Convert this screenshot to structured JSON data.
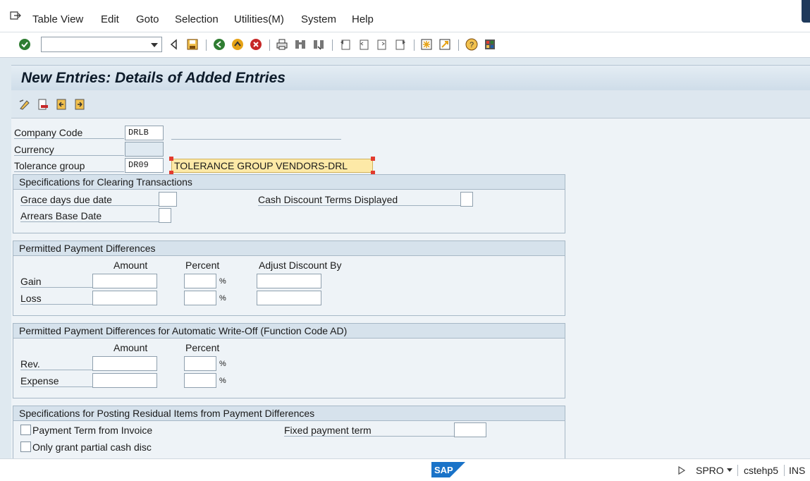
{
  "menubar": {
    "items": [
      "Table View",
      "Edit",
      "Goto",
      "Selection",
      "Utilities(M)",
      "System",
      "Help"
    ]
  },
  "toolbar": {
    "command_value": "",
    "icons": [
      "enter-icon",
      "back-icon",
      "save-icon",
      "back-green-icon",
      "exit-icon",
      "cancel-icon",
      "print-icon",
      "find-icon",
      "find-next-icon",
      "first-page-icon",
      "prev-page-icon",
      "next-page-icon",
      "last-page-icon",
      "create-session-icon",
      "shortcut-icon",
      "help-icon",
      "layout-icon"
    ]
  },
  "screen": {
    "title": "New Entries: Details of Added Entries"
  },
  "app_toolbar": {
    "icons": [
      "change-display-icon",
      "delete-icon",
      "previous-entry-icon",
      "next-entry-icon"
    ]
  },
  "header": {
    "company_code_label": "Company Code",
    "company_code_value": "DRLB",
    "currency_label": "Currency",
    "currency_value": "",
    "tolerance_group_label": "Tolerance group",
    "tolerance_group_value": "DR09",
    "tolerance_group_desc": "TOLERANCE GROUP VENDORS-DRL"
  },
  "clearing": {
    "title": "Specifications for Clearing Transactions",
    "grace_days_label": "Grace days due date",
    "grace_days_value": "",
    "cash_discount_label": "Cash Discount Terms Displayed",
    "cash_discount_value": "",
    "arrears_label": "Arrears Base Date",
    "arrears_value": ""
  },
  "payment_diff": {
    "title": "Permitted Payment Differences",
    "col_amount": "Amount",
    "col_percent": "Percent",
    "col_adjust": "Adjust Discount By",
    "gain_label": "Gain",
    "loss_label": "Loss",
    "pct_symbol": "%",
    "gain_amount": "",
    "gain_percent": "",
    "gain_adjust": "",
    "loss_amount": "",
    "loss_percent": "",
    "loss_adjust": ""
  },
  "writeoff": {
    "title": "Permitted Payment Differences for Automatic Write-Off (Function Code AD)",
    "col_amount": "Amount",
    "col_percent": "Percent",
    "rev_label": "Rev.",
    "expense_label": "Expense",
    "pct_symbol": "%",
    "rev_amount": "",
    "rev_percent": "",
    "expense_amount": "",
    "expense_percent": ""
  },
  "residual": {
    "title": "Specifications for Posting Residual Items from Payment Differences",
    "payment_term_label": "Payment Term from Invoice",
    "partial_cash_label": "Only grant partial cash disc",
    "fixed_term_label": "Fixed payment term",
    "fixed_term_value": ""
  },
  "statusbar": {
    "transaction": "SPRO",
    "server": "cstehp5",
    "mode": "INS"
  },
  "colors": {
    "accent": "#1f3a5c",
    "highlight": "#fde9a7",
    "selection": "#e23b2e"
  }
}
